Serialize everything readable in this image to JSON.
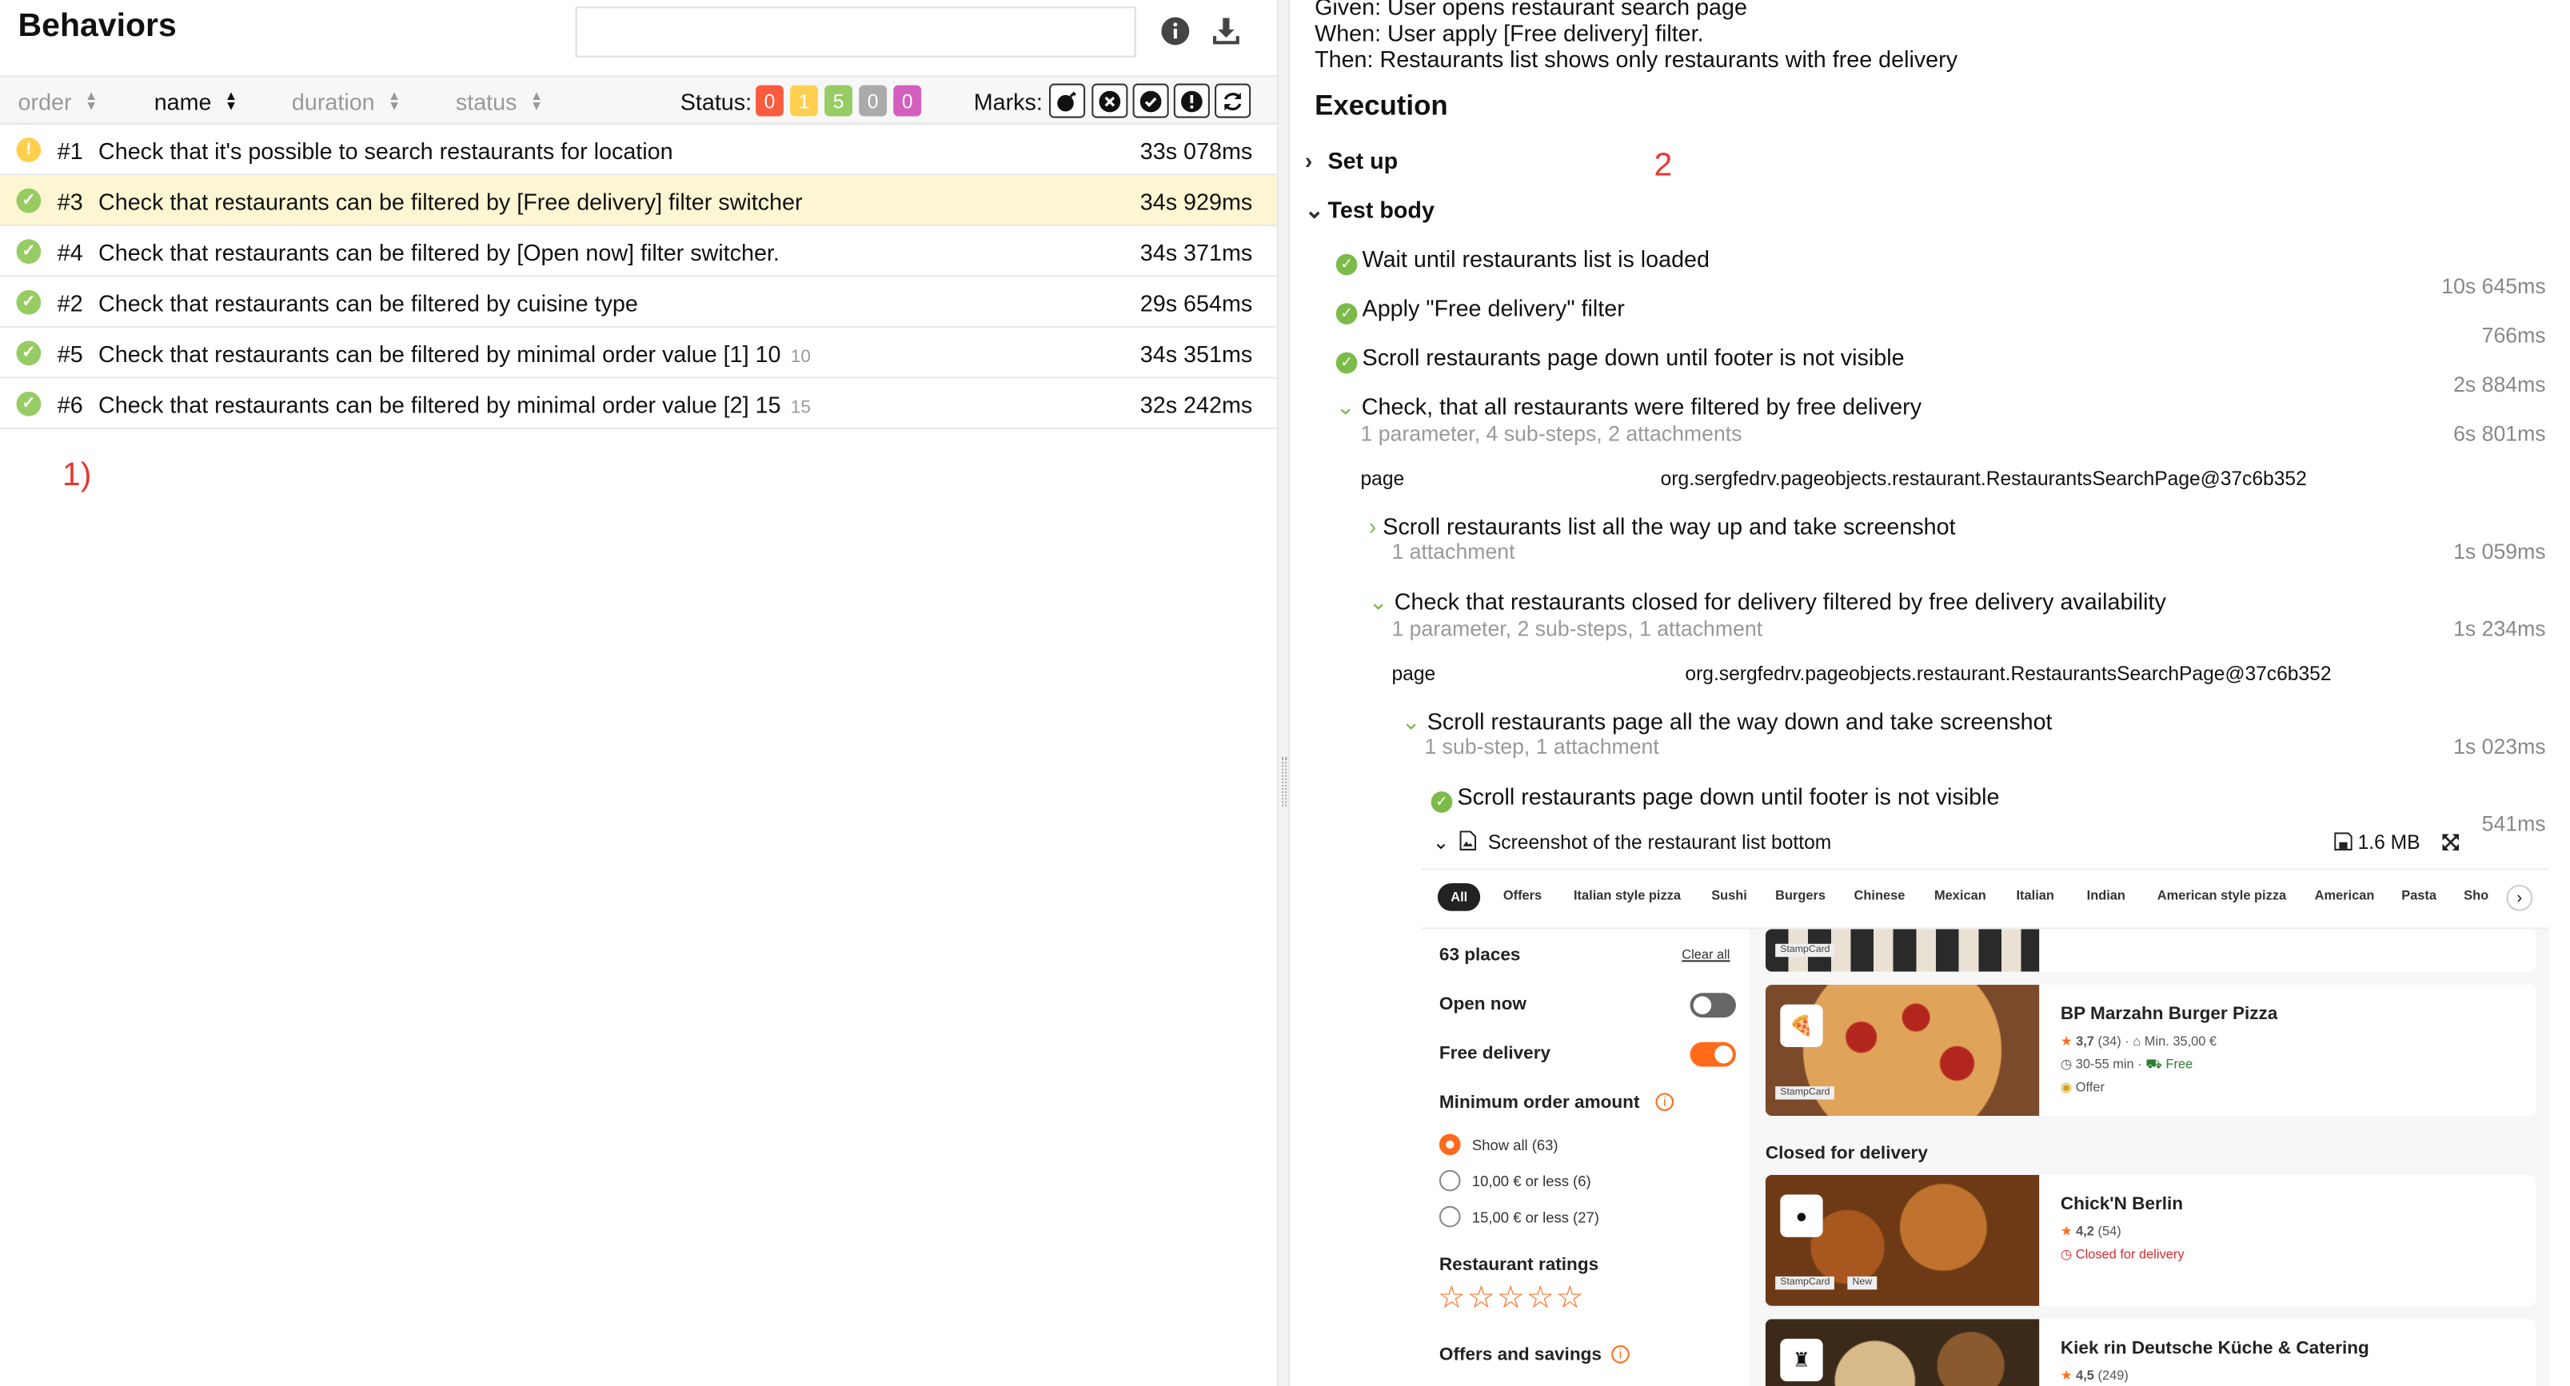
{
  "left": {
    "title": "Behaviors",
    "search_placeholder": "",
    "columns": {
      "order": "order",
      "name": "name",
      "duration": "duration",
      "status": "status"
    },
    "status_label": "Status:",
    "status_counts": [
      {
        "value": "0",
        "color": "#fd5a3e"
      },
      {
        "value": "1",
        "color": "#ffd050"
      },
      {
        "value": "5",
        "color": "#97cc64"
      },
      {
        "value": "0",
        "color": "#aaaaaa"
      },
      {
        "value": "0",
        "color": "#d35ebe"
      }
    ],
    "marks_label": "Marks:",
    "marks": [
      "flaky-icon",
      "new-failed-icon",
      "new-passed-icon",
      "new-broken-icon",
      "retries-icon"
    ],
    "rows": [
      {
        "status": "broken",
        "num": "#1",
        "name": "Check that it's possible to search restaurants for location",
        "param": "",
        "duration": "33s 078ms"
      },
      {
        "status": "passed",
        "num": "#3",
        "name": "Check that restaurants can be filtered by [Free delivery] filter switcher",
        "param": "",
        "duration": "34s 929ms"
      },
      {
        "status": "passed",
        "num": "#4",
        "name": "Check that restaurants can be filtered by [Open now] filter switcher.",
        "param": "",
        "duration": "34s 371ms"
      },
      {
        "status": "passed",
        "num": "#2",
        "name": "Check that restaurants can be filtered by cuisine type",
        "param": "",
        "duration": "29s 654ms"
      },
      {
        "status": "passed",
        "num": "#5",
        "name": "Check that restaurants can be filtered by minimal order value [1] 10",
        "param": "10",
        "duration": "34s 351ms"
      },
      {
        "status": "passed",
        "num": "#6",
        "name": "Check that restaurants can be filtered by minimal order value [2] 15",
        "param": "15",
        "duration": "32s 242ms"
      }
    ],
    "annotation": "1)"
  },
  "right": {
    "gwt": [
      "Given: User opens restaurant search page",
      "When: User apply [Free delivery] filter.",
      "Then: Restaurants list shows only restaurants with free delivery"
    ],
    "execution_title": "Execution",
    "setup_label": "Set up",
    "testbody_label": "Test body",
    "annotation": "2",
    "steps": {
      "wait": {
        "label": "Wait until restaurants list is loaded",
        "time": "10s 645ms"
      },
      "apply": {
        "label": "Apply \"Free delivery\" filter",
        "time": "766ms"
      },
      "scroll": {
        "label": "Scroll restaurants page down until footer is not visible",
        "time": "2s 884ms"
      },
      "check": {
        "label": "Check, that all restaurants were filtered by free delivery",
        "sub": "1 parameter, 4 sub-steps, 2 attachments",
        "time": "6s 801ms",
        "param_name": "page",
        "param_value": "org.sergfedrv.pageobjects.restaurant.RestaurantsSearchPage@37c6b352"
      },
      "scrollup": {
        "label": "Scroll restaurants list all the way up and take screenshot",
        "sub": "1 attachment",
        "time": "1s 059ms"
      },
      "closed": {
        "label": "Check that restaurants closed for delivery filtered by free delivery availability",
        "sub": "1 parameter, 2 sub-steps, 1 attachment",
        "time": "1s 234ms",
        "param_name": "page",
        "param_value": "org.sergfedrv.pageobjects.restaurant.RestaurantsSearchPage@37c6b352"
      },
      "scrolldown": {
        "label": "Scroll restaurants page all the way down and take screenshot",
        "sub": "1 sub-step, 1 attachment",
        "time": "1s 023ms"
      },
      "inner": {
        "label": "Scroll restaurants page down until footer is not visible",
        "time": "541ms"
      },
      "attachment": {
        "label": "Screenshot of the restaurant list bottom",
        "size": "1.6 MB"
      }
    },
    "shot": {
      "chips": [
        "All",
        "Offers",
        "Italian style pizza",
        "Sushi",
        "Burgers",
        "Chinese",
        "Mexican",
        "Italian",
        "Indian",
        "American style pizza",
        "American",
        "Pasta",
        "Sho"
      ],
      "places": "63 places",
      "clear_all": "Clear all",
      "open_now": "Open now",
      "free_delivery": "Free delivery",
      "min_order": "Minimum order amount",
      "radios": [
        "Show all (63)",
        "10,00 € or less (6)",
        "15,00 € or less (27)"
      ],
      "ratings": "Restaurant ratings",
      "stars": "☆☆☆☆☆",
      "offers": "Offers and savings",
      "stampcard": "StampCard",
      "new_tag": "New",
      "closed_heading": "Closed for delivery",
      "r1_name": "BP Marzahn Burger Pizza",
      "r1_rating": "3,7",
      "r1_count": "(34)",
      "r1_min": "Min. 35,00 €",
      "r1_time": "30-55 min",
      "r1_free": "Free",
      "r1_offer": "Offer",
      "r2_name": "Chick'N Berlin",
      "r2_rating": "4,2",
      "r2_count": "(54)",
      "r2_closed": "Closed for delivery",
      "r3_name": "Kiek rin Deutsche Küche & Catering",
      "r3_rating": "4,5",
      "r3_count": "(249)"
    }
  }
}
